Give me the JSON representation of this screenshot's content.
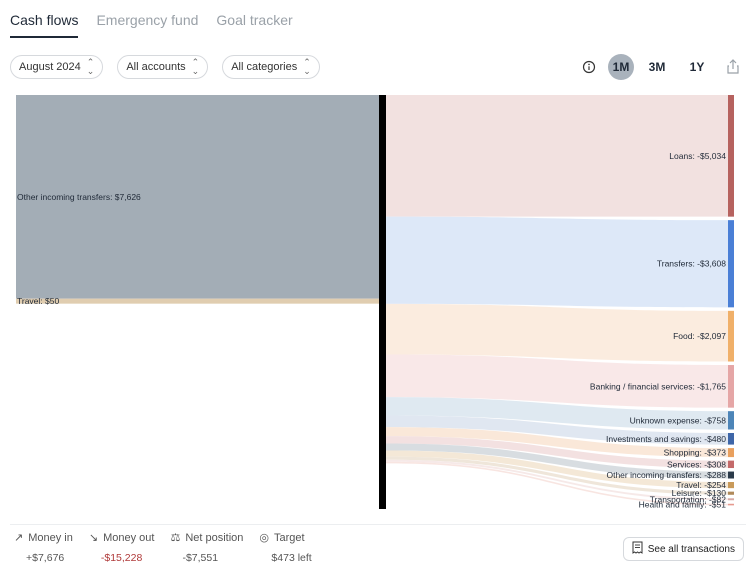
{
  "tabs": [
    {
      "label": "Cash flows",
      "active": true
    },
    {
      "label": "Emergency fund",
      "active": false
    },
    {
      "label": "Goal tracker",
      "active": false
    }
  ],
  "filters": {
    "month": "August 2024",
    "accounts": "All accounts",
    "categories": "All categories"
  },
  "range": {
    "options": [
      "1M",
      "3M",
      "1Y"
    ],
    "selected": "1M"
  },
  "icons": {
    "info": "info-icon",
    "share": "share-icon",
    "money_in": "arrow-up-right-icon",
    "money_out": "arrow-down-right-icon",
    "net_position": "scale-icon",
    "target": "target-icon",
    "transactions": "receipt-icon"
  },
  "sankey": {
    "incoming": [
      {
        "label": "Other incoming transfers: $7,626",
        "value": 7626,
        "color": "#a3adb6"
      },
      {
        "label": "Travel: $50",
        "value": 50,
        "color": "#e0cdb0"
      }
    ],
    "outgoing": [
      {
        "label": "Loans: -$5,034",
        "value": 5034,
        "color": "#b6625f",
        "flow": "#f1dedd"
      },
      {
        "label": "Transfers: -$3,608",
        "value": 3608,
        "color": "#4a7fd6",
        "flow": "#d9e5f7"
      },
      {
        "label": "Food: -$2,097",
        "value": 2097,
        "color": "#f0b069",
        "flow": "#fbeadc"
      },
      {
        "label": "Banking / financial services: -$1,765",
        "value": 1765,
        "color": "#e5a6a6",
        "flow": "#f8e6e5"
      },
      {
        "label": "Unknown expense: -$758",
        "value": 758,
        "color": "#4d85b8",
        "flow": "#dbe7ef"
      },
      {
        "label": "Investments and savings: -$480",
        "value": 480,
        "color": "#3e66a8",
        "flow": "#dde4f0"
      },
      {
        "label": "Shopping: -$373",
        "value": 373,
        "color": "#e9a05e",
        "flow": "#f9e6d5"
      },
      {
        "label": "Services: -$308",
        "value": 308,
        "color": "#c46a6a",
        "flow": "#f2dede"
      },
      {
        "label": "Other incoming transfers: -$288",
        "value": 288,
        "color": "#2b3a4a",
        "flow": "#d4d9de"
      },
      {
        "label": "Travel: -$254",
        "value": 254,
        "color": "#c99a5a",
        "flow": "#f3e6d3"
      },
      {
        "label": "Leisure: -$130",
        "value": 130,
        "color": "#b08a5a",
        "flow": "#ede3d6"
      },
      {
        "label": "Transportation: -$82",
        "value": 82,
        "color": "#d7a9a4",
        "flow": "#f5e7e5"
      },
      {
        "label": "Health and family: -$51",
        "value": 51,
        "color": "#e69a8f",
        "flow": "#f7e2de"
      }
    ]
  },
  "summary": [
    {
      "label": "Money in",
      "value": "+$7,676",
      "negative": false
    },
    {
      "label": "Money out",
      "value": "-$15,228",
      "negative": true
    },
    {
      "label": "Net position",
      "value": "-$7,551",
      "negative": false
    },
    {
      "label": "Target",
      "value": "$473 left",
      "negative": false
    }
  ],
  "see_all_label": "See all transactions"
}
